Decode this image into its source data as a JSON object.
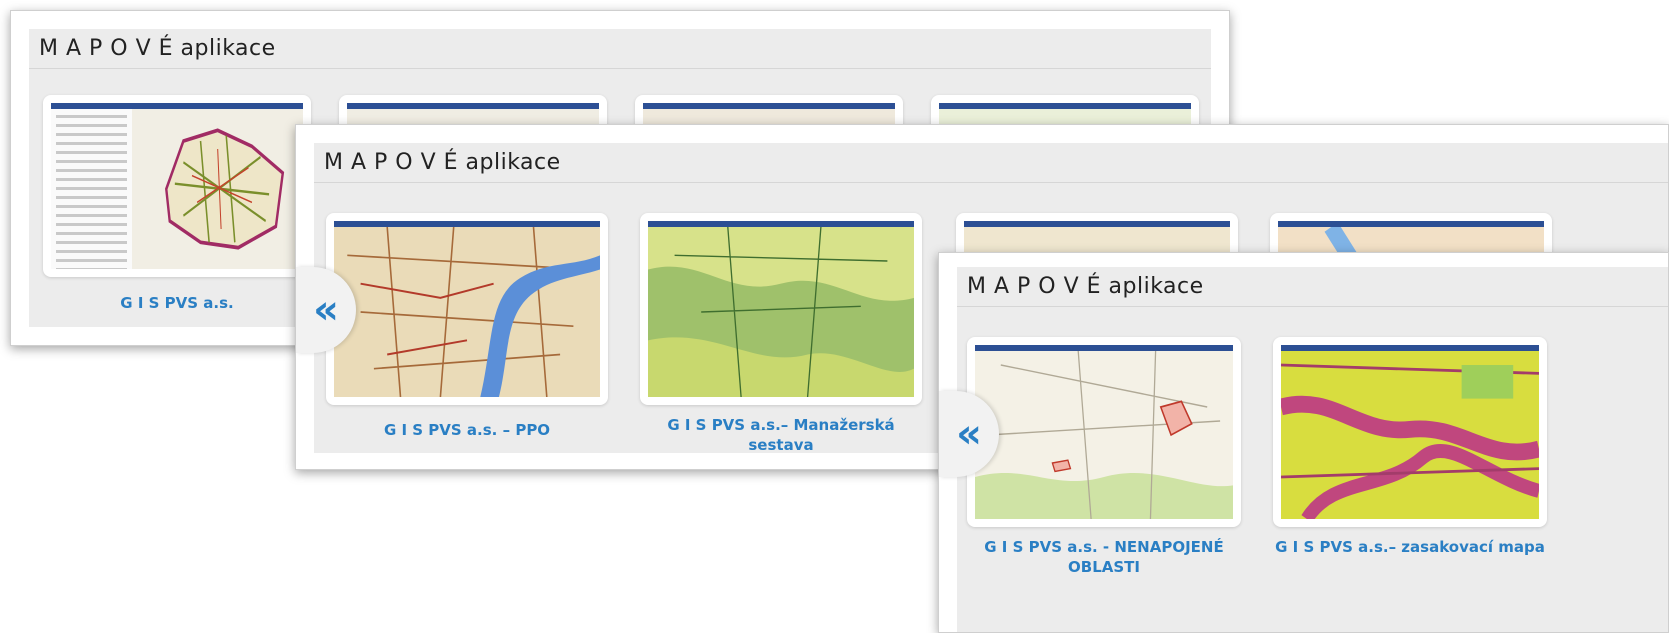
{
  "panels": [
    {
      "title": "M A P O V É aplikace",
      "cards": [
        {
          "caption": "G I S PVS a.s.",
          "thumb": "prague-network-map"
        },
        {
          "caption": "",
          "thumb": "map-topo"
        },
        {
          "caption": "",
          "thumb": "map-topo"
        },
        {
          "caption": "",
          "thumb": "map-topo"
        }
      ]
    },
    {
      "title": "M A P O V É aplikace",
      "prev_icon": "«",
      "cards": [
        {
          "caption": "G I S PVS a.s. – PPO",
          "thumb": "map-river"
        },
        {
          "caption": "G I S PVS a.s.– Manažerská sestava",
          "thumb": "map-green"
        },
        {
          "caption": "",
          "thumb": "map-topo"
        },
        {
          "caption": "",
          "thumb": "map-topo"
        }
      ]
    },
    {
      "title": "M A P O V É aplikace",
      "prev_icon": "«",
      "cards": [
        {
          "caption": "G I S PVS a.s. - NENAPOJENÉ OBLASTI",
          "thumb": "map-areas"
        },
        {
          "caption": "G I S PVS a.s.– zasakovací mapa",
          "thumb": "map-infiltration"
        }
      ]
    }
  ],
  "colors": {
    "accent": "#2a7fc4",
    "header_bar": "#2c4f94",
    "panel_bg": "#ececec"
  }
}
